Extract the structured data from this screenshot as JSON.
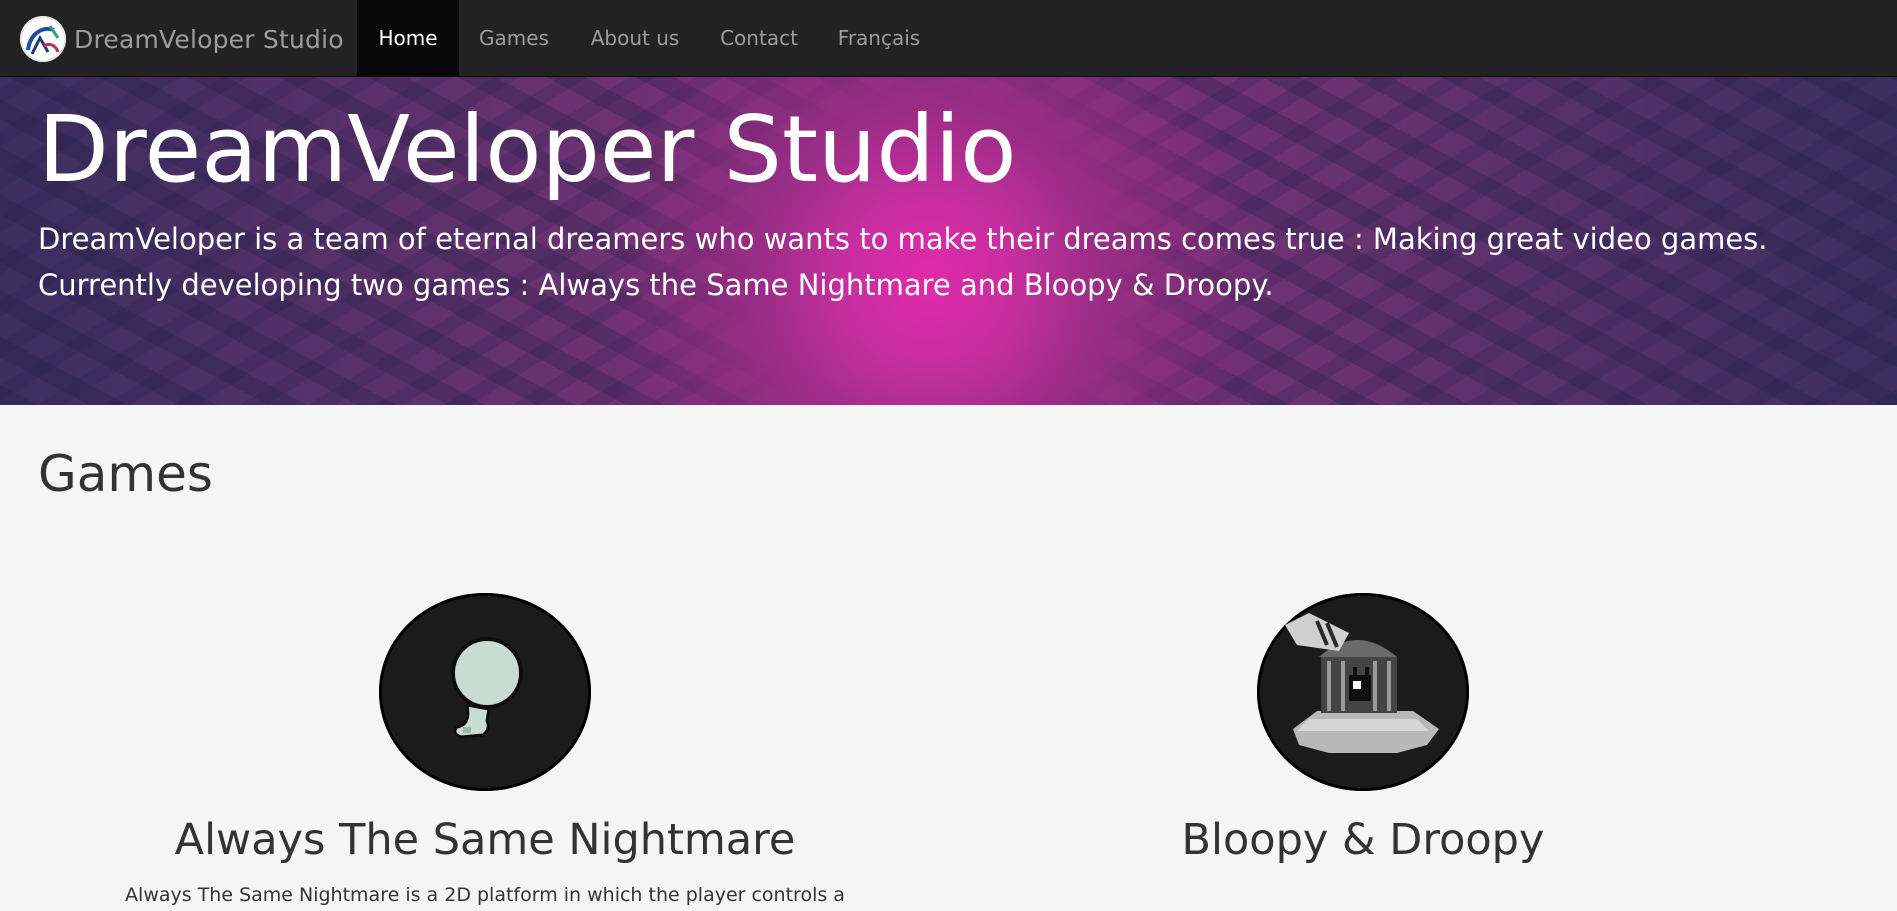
{
  "navbar": {
    "brand": "DreamVeloper Studio",
    "items": [
      {
        "label": "Home",
        "active": true
      },
      {
        "label": "Games",
        "active": false
      },
      {
        "label": "About us",
        "active": false
      },
      {
        "label": "Contact",
        "active": false
      },
      {
        "label": "Français",
        "active": false
      }
    ]
  },
  "hero": {
    "title": "DreamVeloper Studio",
    "text": "DreamVeloper is a team of eternal dreamers who wants to make their dreams comes true : Making great video games. Currently developing two games : Always the Same Nightmare and Bloopy & Droopy."
  },
  "games": {
    "heading": "Games",
    "items": [
      {
        "title": "Always The Same Nightmare",
        "description": "Always The Same Nightmare is a 2D platform in which the player controls a",
        "icon": "ghost-character-icon"
      },
      {
        "title": "Bloopy & Droopy",
        "description": "",
        "icon": "pixel-creature-icon"
      }
    ]
  },
  "colors": {
    "navbar_bg": "#222222",
    "nav_active_bg": "#080808",
    "nav_text": "#9d9d9d",
    "page_bg": "#f5f5f5",
    "hero_accent": "#e02aaa"
  }
}
